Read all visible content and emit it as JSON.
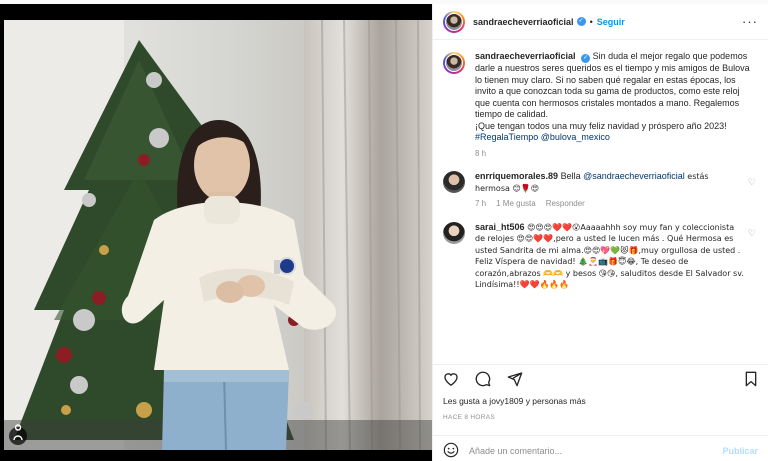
{
  "post": {
    "image_alt": "Mujer con suéter blanco junto a un árbol de Navidad mostrando un reloj"
  },
  "header": {
    "username": "sandraecheverriaoficial",
    "separator": "•",
    "follow_label": "Seguir",
    "more_label": "···"
  },
  "caption": {
    "username": "sandraecheverriaoficial",
    "text": "Sin duda el mejor regalo que podemos darle a nuestros seres queridos es el tiempo y mis amigos de Bulova lo tienen muy claro. Si no saben qué regalar en estas épocas, los invito a que conozcan toda su gama de productos, como este reloj que cuenta con hermosos cristales montados a mano. Regalemos tiempo de calidad.",
    "text2": "¡Que tengan todos una muy feliz navidad y próspero año 2023!",
    "hashtag": "#RegalaTiempo",
    "mention": "@bulova_mexico",
    "age": "8 h"
  },
  "comments": [
    {
      "username": "enrriquemorales.89",
      "text_prefix": "Bella",
      "mention": "@sandraecheverriaoficial",
      "text_suffix": "estás hermosa 😊🌹😍",
      "age": "7 h",
      "likes": "1 Me gusta",
      "reply": "Responder"
    },
    {
      "username": "sarai_ht506",
      "text": "😍😍😍❤️❤️😮Aaaaahhh soy muy fan y coleccionista de relojes 😍😍❤️❤️,pero a usted le lucen más . Qué Hermosa es usted Sandrita de mi alma.😍😍💖💚😻🎁,muy orgullosa de usted . Feliz Víspera de navidad! 🎄🎅📺🎁😇😂, Te deseo de corazón,abrazos 🫶🫶 y besos 😘😘, saluditos desde El Salvador sv. Lindísima!!❤️❤️🔥🔥🔥"
    }
  ],
  "footer": {
    "likes_text": "Les gusta a jovy1809 y personas más",
    "timestamp": "HACE 8 HORAS",
    "comment_placeholder": "Añade un comentario...",
    "publish_label": "Publicar"
  },
  "icons": {
    "heart": "heart-icon",
    "comment": "comment-icon",
    "share": "share-icon",
    "save": "bookmark-icon",
    "emoji": "emoji-icon",
    "verified": "verified-badge-icon"
  },
  "colors": {
    "accent": "#0095f6",
    "link": "#00376b",
    "muted": "#8e8e8e",
    "verified": "#3897f0"
  }
}
